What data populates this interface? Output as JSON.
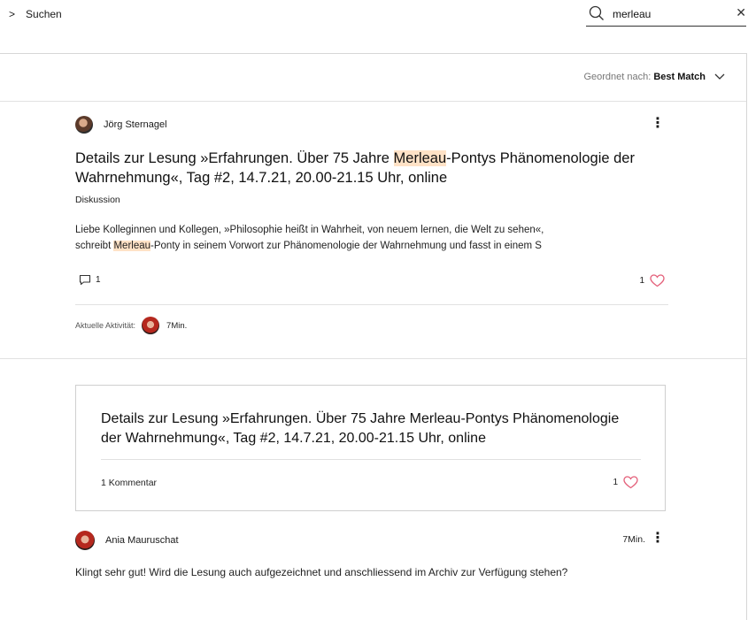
{
  "breadcrumb": {
    "label": "Suchen"
  },
  "search": {
    "value": "merleau",
    "placeholder": ""
  },
  "sort": {
    "prefix": "Geordnet nach:",
    "value": "Best Match"
  },
  "post": {
    "author": "Jörg Sternagel",
    "title_parts": [
      "Details zur Lesung »Erfahrungen. Über 75 Jahre ",
      "Merleau",
      "-Pontys Phänomenologie der Wahrnehmung«, Tag #2, 14.7.21, 20.00-21.15 Uhr, online"
    ],
    "tag": "Diskussion",
    "excerpt_line1": "Liebe Kolleginnen und Kollegen, »Philosophie heißt in Wahrheit, von neuem lernen, die Welt zu sehen«,",
    "excerpt_line2_parts": [
      "schreibt ",
      "Merleau",
      "-Ponty in seinem Vorwort zur Phänomenologie der Wahrnehmung und fasst in einem S"
    ],
    "comment_count": "1",
    "like_count": "1",
    "activity_label": "Aktuelle Aktivität:",
    "activity_time": "7Min."
  },
  "card": {
    "title": "Details zur Lesung »Erfahrungen. Über 75 Jahre Merleau-Pontys Phänomenologie der Wahrnehmung«, Tag #2, 14.7.21, 20.00-21.15 Uhr, online",
    "comments_label": "1 Kommentar",
    "like_count": "1"
  },
  "reply": {
    "author": "Ania Mauruschat",
    "time": "7Min.",
    "text": "Klingt sehr gut! Wird die Lesung auch aufgezeichnet und anschliessend im Archiv zur Verfügung stehen?"
  },
  "colors": {
    "highlight": "#ffe2c6",
    "heart": "#e4607a",
    "border": "#d6d6d6"
  },
  "icons": [
    "chevron-right-icon",
    "search-icon",
    "close-icon",
    "chevron-down-icon",
    "more-vertical-icon",
    "comment-icon",
    "heart-icon"
  ]
}
